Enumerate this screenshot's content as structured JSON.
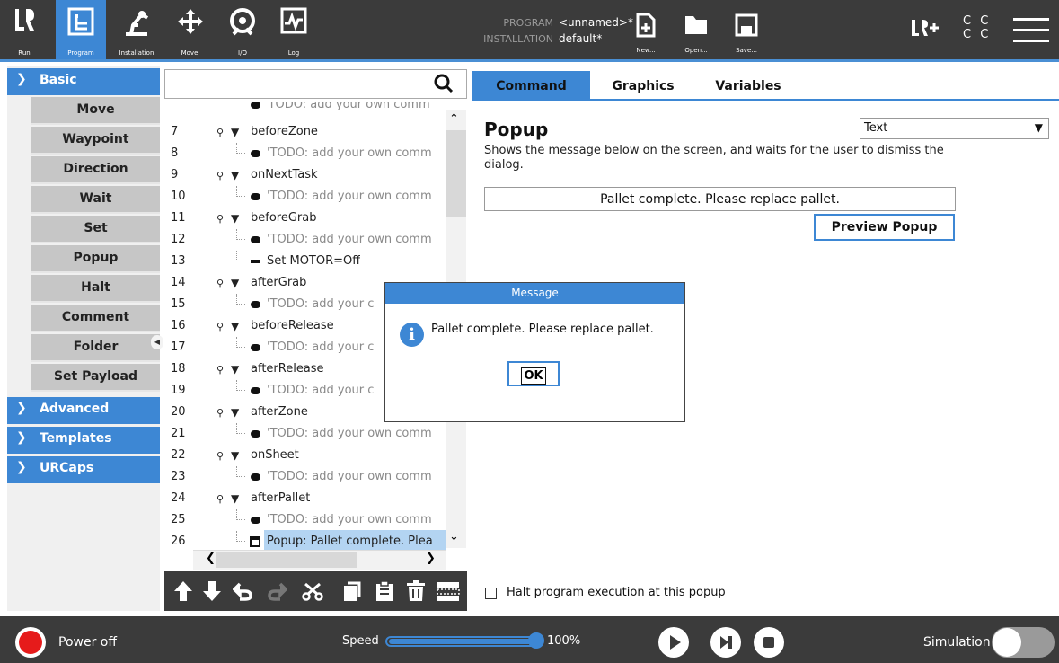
{
  "nav": [
    {
      "label": "Run",
      "icon": "ur-logo-icon"
    },
    {
      "label": "Program",
      "icon": "program-icon"
    },
    {
      "label": "Installation",
      "icon": "installation-icon"
    },
    {
      "label": "Move",
      "icon": "move-icon"
    },
    {
      "label": "I/O",
      "icon": "io-icon"
    },
    {
      "label": "Log",
      "icon": "log-icon"
    }
  ],
  "header": {
    "program_key": "PROGRAM",
    "program_value": "<unnamed>*",
    "installation_key": "INSTALLATION",
    "installation_value": "default*"
  },
  "file_buttons": {
    "new": "New...",
    "open": "Open...",
    "save": "Save..."
  },
  "status": {
    "cc_line1": "C C",
    "cc_line2": "C C"
  },
  "sidebar": {
    "basic": "Basic",
    "items": [
      "Move",
      "Waypoint",
      "Direction",
      "Wait",
      "Set",
      "Popup",
      "Halt",
      "Comment",
      "Folder",
      "Set Payload"
    ],
    "advanced": "Advanced",
    "templates": "Templates",
    "urcaps": "URCaps"
  },
  "search": {
    "placeholder": ""
  },
  "tree": {
    "partial_top": "'TODO: add your own comm",
    "rows": [
      {
        "n": "7",
        "text": "beforeZone",
        "type": "event"
      },
      {
        "n": "8",
        "text": "'TODO: add your own comm",
        "type": "comment"
      },
      {
        "n": "9",
        "text": "onNextTask",
        "type": "event"
      },
      {
        "n": "10",
        "text": "'TODO: add your own comm",
        "type": "comment"
      },
      {
        "n": "11",
        "text": "beforeGrab",
        "type": "event"
      },
      {
        "n": "12",
        "text": "'TODO: add your own comm",
        "type": "comment"
      },
      {
        "n": "13",
        "text": "Set MOTOR=Off",
        "type": "set"
      },
      {
        "n": "14",
        "text": "afterGrab",
        "type": "event"
      },
      {
        "n": "15",
        "text": "'TODO: add your c",
        "type": "comment"
      },
      {
        "n": "16",
        "text": "beforeRelease",
        "type": "event"
      },
      {
        "n": "17",
        "text": "'TODO: add your c",
        "type": "comment"
      },
      {
        "n": "18",
        "text": "afterRelease",
        "type": "event"
      },
      {
        "n": "19",
        "text": "'TODO: add your c",
        "type": "comment"
      },
      {
        "n": "20",
        "text": "afterZone",
        "type": "event"
      },
      {
        "n": "21",
        "text": "'TODO: add your own comm",
        "type": "comment"
      },
      {
        "n": "22",
        "text": "onSheet",
        "type": "event"
      },
      {
        "n": "23",
        "text": "'TODO: add your own comm",
        "type": "comment"
      },
      {
        "n": "24",
        "text": "afterPallet",
        "type": "event"
      },
      {
        "n": "25",
        "text": "'TODO: add your own comm",
        "type": "comment"
      },
      {
        "n": "26",
        "text": "Popup: Pallet complete. Plea",
        "type": "popup"
      }
    ]
  },
  "tabs": [
    "Command",
    "Graphics",
    "Variables"
  ],
  "popup": {
    "title": "Popup",
    "type_selected": "Text",
    "description": "Shows the message below on the screen, and waits for the user to dismiss the dialog.",
    "message": "Pallet complete. Please replace pallet.",
    "preview_label": "Preview Popup",
    "halt_label": "Halt program execution at this popup",
    "halt_checked": false
  },
  "dialog": {
    "title": "Message",
    "text": "Pallet complete. Please replace pallet.",
    "ok_label": "OK"
  },
  "bottom": {
    "power_label": "Power off",
    "speed_label": "Speed",
    "speed_value": "100%",
    "speed_fraction": 1.0,
    "simulation_label": "Simulation"
  },
  "colors": {
    "accent": "#3d87d4",
    "bar": "#3b3b3b",
    "power": "#e61b1b"
  }
}
